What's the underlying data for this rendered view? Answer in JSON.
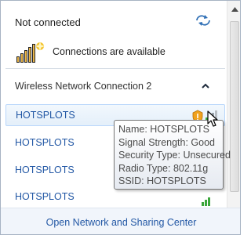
{
  "status": {
    "title": "Not connected",
    "icons": {
      "refresh": "refresh-icon",
      "connections": "network-bars-star-icon"
    },
    "connections_text": "Connections are available"
  },
  "section": {
    "title": "Wireless Network Connection 2",
    "toggle_icon": "chevron-up-icon"
  },
  "networks": [
    {
      "name": "HOTSPLOTS",
      "signal": "good",
      "secured": false,
      "selected": true
    },
    {
      "name": "HOTSPLOTS",
      "signal": "good",
      "secured": false,
      "selected": false
    },
    {
      "name": "HOTSPLOTS",
      "signal": "good",
      "secured": false,
      "selected": false
    },
    {
      "name": "HOTSPLOTS",
      "signal": "good",
      "secured": false,
      "selected": false
    }
  ],
  "tooltip": {
    "name": "Name: HOTSPLOTS",
    "signal": "Signal Strength: Good",
    "security": "Security Type: Unsecured",
    "radio": "Radio Type: 802.11g",
    "ssid": "SSID: HOTSPLOTS"
  },
  "footer": {
    "link": "Open Network and Sharing Center"
  },
  "colors": {
    "link": "#2358a5",
    "selection_border": "#b8d6fb",
    "signal_green": "#3aa63a",
    "warning_orange": "#f0a21e"
  }
}
